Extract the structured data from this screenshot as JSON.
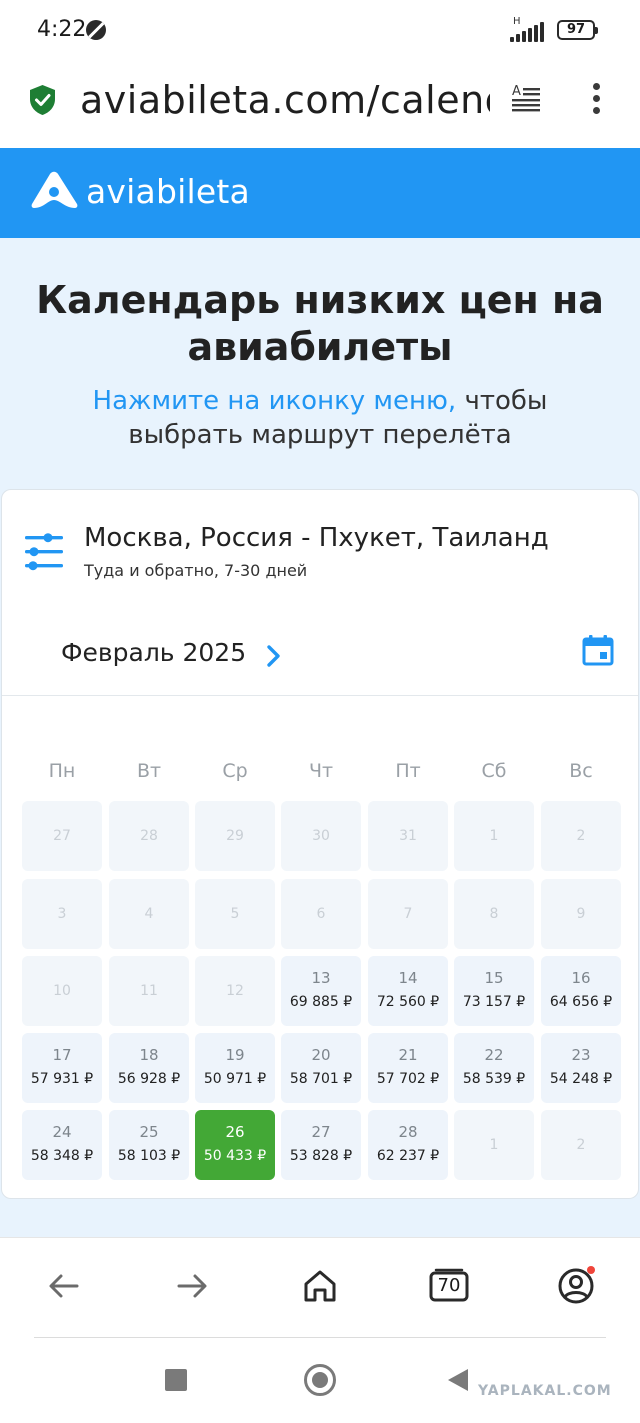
{
  "status_bar": {
    "time": "4:22",
    "network": "H",
    "battery": "97"
  },
  "browser": {
    "url": "aviabileta.com/calendar",
    "tabs_count": "70"
  },
  "site": {
    "logo_text": "aviabileta"
  },
  "hero": {
    "title_line1": "Календарь низких цен на",
    "title_line2": "авиабилеты",
    "sub_link": "Нажмите на иконку меню,",
    "sub_rest": " чтобы",
    "sub_line2": "выбрать маршрут перелёта"
  },
  "search": {
    "route": "Москва, Россия - Пхукет, Таиланд",
    "trip": "Туда и обратно, 7-30 дней"
  },
  "calendar": {
    "month": "Февраль 2025",
    "weekdays": [
      "Пн",
      "Вт",
      "Ср",
      "Чт",
      "Пт",
      "Сб",
      "Вс"
    ],
    "weeks": [
      [
        {
          "d": "27"
        },
        {
          "d": "28"
        },
        {
          "d": "29"
        },
        {
          "d": "30"
        },
        {
          "d": "31"
        },
        {
          "d": "1"
        },
        {
          "d": "2"
        }
      ],
      [
        {
          "d": "3"
        },
        {
          "d": "4"
        },
        {
          "d": "5"
        },
        {
          "d": "6"
        },
        {
          "d": "7"
        },
        {
          "d": "8"
        },
        {
          "d": "9"
        }
      ],
      [
        {
          "d": "10"
        },
        {
          "d": "11"
        },
        {
          "d": "12"
        },
        {
          "d": "13",
          "p": "69 885 ₽"
        },
        {
          "d": "14",
          "p": "72 560 ₽"
        },
        {
          "d": "15",
          "p": "73 157 ₽"
        },
        {
          "d": "16",
          "p": "64 656 ₽"
        }
      ],
      [
        {
          "d": "17",
          "p": "57 931 ₽"
        },
        {
          "d": "18",
          "p": "56 928 ₽"
        },
        {
          "d": "19",
          "p": "50 971 ₽"
        },
        {
          "d": "20",
          "p": "58 701 ₽"
        },
        {
          "d": "21",
          "p": "57 702 ₽"
        },
        {
          "d": "22",
          "p": "58 539 ₽"
        },
        {
          "d": "23",
          "p": "54 248 ₽"
        }
      ],
      [
        {
          "d": "24",
          "p": "58 348 ₽"
        },
        {
          "d": "25",
          "p": "58 103 ₽"
        },
        {
          "d": "26",
          "p": "50 433 ₽",
          "selected": true
        },
        {
          "d": "27",
          "p": "53 828 ₽"
        },
        {
          "d": "28",
          "p": "62 237 ₽"
        },
        {
          "d": "1"
        },
        {
          "d": "2"
        }
      ]
    ]
  },
  "watermark": "YAPLAKAL.COM",
  "colors": {
    "brand_blue": "#2196f3",
    "selected_green": "#43a836",
    "hero_bg": "#e8f3fd"
  }
}
